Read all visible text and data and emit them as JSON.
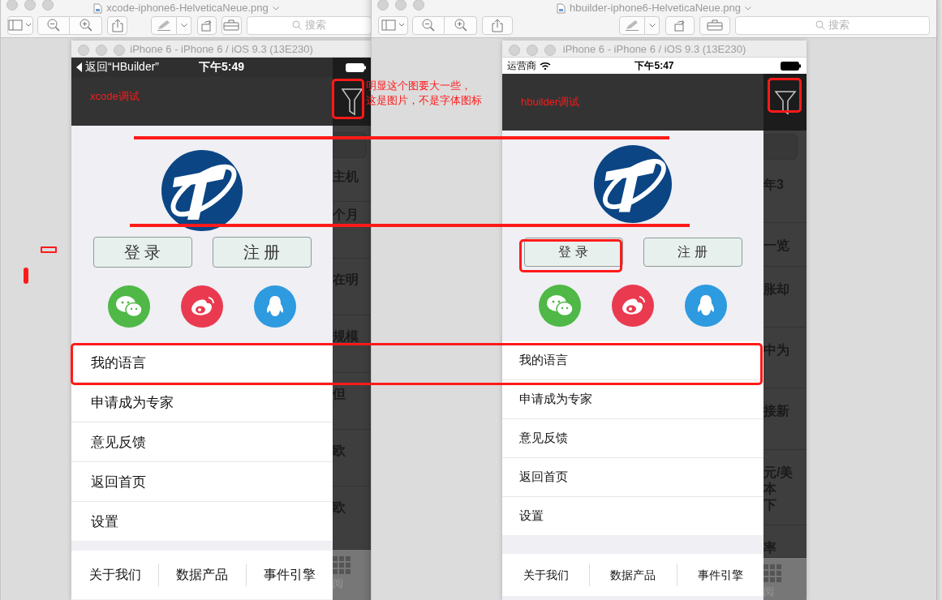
{
  "windows": [
    {
      "file": "xcode-iphone6-HelveticaNeue.png",
      "search_placeholder": "搜索",
      "simulator": {
        "title": "iPhone 6 - iPhone 6 / iOS 9.3 (13E230)",
        "status": {
          "kind": "dark",
          "back": "返回“HBuilder”",
          "time": "下午5:49"
        },
        "nav_label": "xcode调试",
        "buttons": [
          "登 录",
          "注 册"
        ],
        "socials": [
          {
            "kind": "chat",
            "color": "#4fb847"
          },
          {
            "kind": "weibo",
            "color": "#ea3a4f"
          },
          {
            "kind": "penguin",
            "color": "#2e9ae0"
          }
        ],
        "menu": [
          "我的语言",
          "申请成为专家",
          "意见反馈",
          "返回首页",
          "设置"
        ],
        "bottom_tabs": [
          "关于我们",
          "数据产品",
          "事件引擎"
        ],
        "behind": {
          "rows": [
            {
              "lines": [
                "主机"
              ]
            },
            {
              "lines": [
                "个月"
              ]
            },
            {
              "lines": [
                "在明"
              ]
            },
            {
              "lines": [
                "规模"
              ]
            },
            {
              "lines": [
                "但"
              ]
            },
            {
              "lines": [
                "欧"
              ]
            },
            {
              "lines": [
                "欧"
              ]
            }
          ],
          "tab": "阅"
        }
      }
    },
    {
      "file": "hbuilder-iphone6-HelveticaNeue.png",
      "search_placeholder": "搜索",
      "simulator": {
        "title": "iPhone 6 - iPhone 6 / iOS 9.3 (13E230)",
        "status": {
          "kind": "light",
          "carrier": "运营商",
          "time": "下午5:47"
        },
        "nav_label": "hbuilder调试",
        "buttons": [
          "登 录",
          "注 册"
        ],
        "socials": [
          {
            "kind": "chat",
            "color": "#4fb847"
          },
          {
            "kind": "weibo",
            "color": "#ea3a4f"
          },
          {
            "kind": "penguin",
            "color": "#2e9ae0"
          }
        ],
        "menu": [
          "我的语言",
          "申请成为专家",
          "意见反馈",
          "返回首页",
          "设置"
        ],
        "bottom_tabs": [
          "关于我们",
          "数据产品",
          "事件引擎"
        ],
        "behind": {
          "rows": [
            {
              "lines": [
                "年3"
              ]
            },
            {
              "lines": [
                "一览"
              ]
            },
            {
              "lines": [
                "胀却"
              ]
            },
            {
              "lines": [
                "中为"
              ]
            },
            {
              "lines": [
                "接新"
              ]
            },
            {
              "lines": [
                "元/美",
                "本",
                "下"
              ]
            },
            {
              "lines": [
                "率"
              ]
            }
          ],
          "tab": "阅"
        }
      }
    }
  ],
  "annotations": [
    {
      "kind": "line"
    },
    {
      "kind": "line"
    },
    {
      "kind": "box"
    },
    {
      "kind": "note",
      "lines": [
        "明显这个图要大一些，",
        "这是图片，不是字体图标"
      ]
    },
    {
      "kind": "box"
    },
    {
      "kind": "box"
    },
    {
      "kind": "box"
    },
    {
      "kind": "mark"
    },
    {
      "kind": "bar"
    }
  ]
}
